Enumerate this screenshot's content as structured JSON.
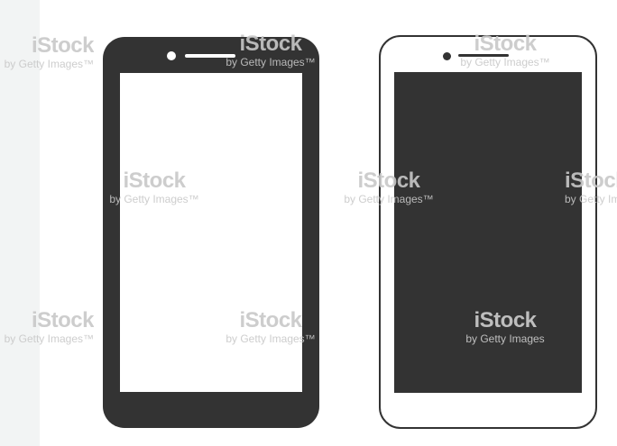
{
  "watermark": {
    "brand": "iStock",
    "byline": "by Getty Images",
    "byline_tm": "by Getty Images™"
  },
  "colors": {
    "phone_dark": "#333333",
    "phone_light_frame": "#ffffff",
    "screen_white": "#ffffff",
    "side_strip": "#f2f4f4",
    "watermark": "#c8c8c8"
  },
  "icons": [
    "smartphone-dark-icon",
    "smartphone-light-icon"
  ]
}
